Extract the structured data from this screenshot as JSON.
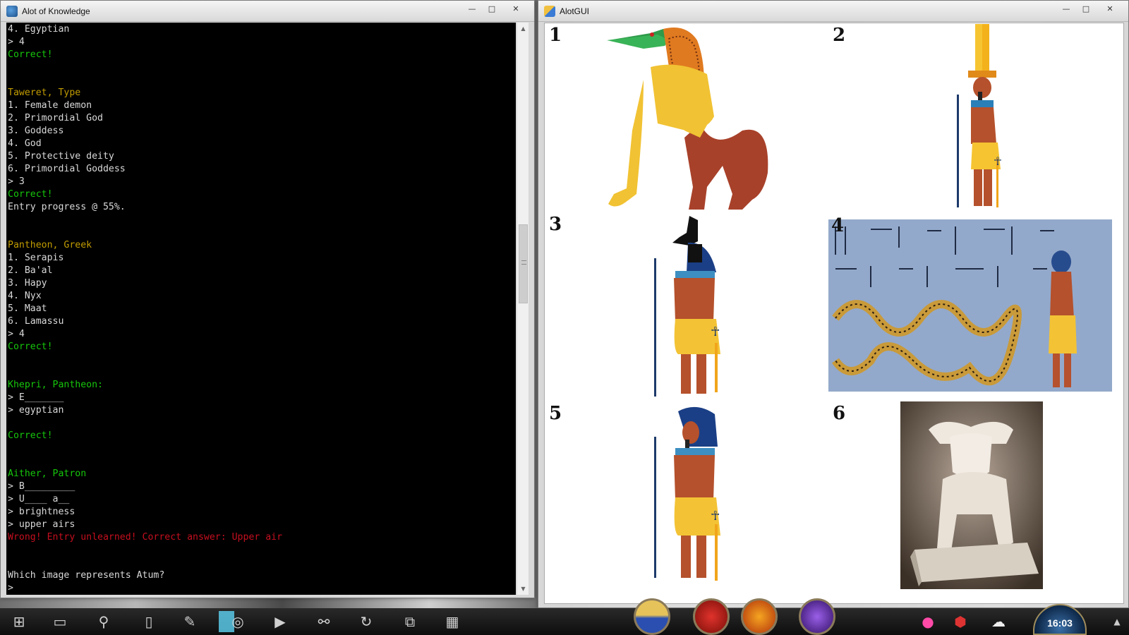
{
  "console_window": {
    "title": "Alot of Knowledge",
    "controls": {
      "minimize": "—",
      "maximize": "□",
      "close": "✕"
    },
    "lines": [
      {
        "text": "4. Egyptian",
        "style": "normal"
      },
      {
        "text": "> 4",
        "style": "normal"
      },
      {
        "text": "Correct!",
        "style": "green"
      },
      {
        "text": "",
        "style": "normal"
      },
      {
        "text": "",
        "style": "normal"
      },
      {
        "text": "Taweret, Type",
        "style": "olive"
      },
      {
        "text": "1. Female demon",
        "style": "normal"
      },
      {
        "text": "2. Primordial God",
        "style": "normal"
      },
      {
        "text": "3. Goddess",
        "style": "normal"
      },
      {
        "text": "4. God",
        "style": "normal"
      },
      {
        "text": "5. Protective deity",
        "style": "normal"
      },
      {
        "text": "6. Primordial Goddess",
        "style": "normal"
      },
      {
        "text": "> 3",
        "style": "normal"
      },
      {
        "text": "Correct!",
        "style": "green"
      },
      {
        "text": "Entry progress @ 55%.",
        "style": "normal"
      },
      {
        "text": "",
        "style": "normal"
      },
      {
        "text": "",
        "style": "normal"
      },
      {
        "text": "Pantheon, Greek",
        "style": "olive"
      },
      {
        "text": "1. Serapis",
        "style": "normal"
      },
      {
        "text": "2. Ba'al",
        "style": "normal"
      },
      {
        "text": "3. Hapy",
        "style": "normal"
      },
      {
        "text": "4. Nyx",
        "style": "normal"
      },
      {
        "text": "5. Maat",
        "style": "normal"
      },
      {
        "text": "6. Lamassu",
        "style": "normal"
      },
      {
        "text": "> 4",
        "style": "normal"
      },
      {
        "text": "Correct!",
        "style": "green"
      },
      {
        "text": "",
        "style": "normal"
      },
      {
        "text": "",
        "style": "normal"
      },
      {
        "text": "Khepri, Pantheon:",
        "style": "green"
      },
      {
        "text": "> E_______",
        "style": "normal"
      },
      {
        "text": "> egyptian",
        "style": "normal"
      },
      {
        "text": "",
        "style": "normal"
      },
      {
        "text": "Correct!",
        "style": "green"
      },
      {
        "text": "",
        "style": "normal"
      },
      {
        "text": "",
        "style": "normal"
      },
      {
        "text": "Aither, Patron",
        "style": "green"
      },
      {
        "text": "> B_________",
        "style": "normal"
      },
      {
        "text": "> U____ a__",
        "style": "normal"
      },
      {
        "text": "> brightness",
        "style": "normal"
      },
      {
        "text": "> upper airs",
        "style": "normal"
      },
      {
        "text": "Wrong! Entry unlearned! Correct answer: Upper air",
        "style": "red"
      },
      {
        "text": "",
        "style": "normal"
      },
      {
        "text": "",
        "style": "normal"
      },
      {
        "text": "Which image represents Atum?",
        "style": "normal"
      },
      {
        "text": ">",
        "style": "normal"
      }
    ]
  },
  "gui_window": {
    "title": "AlotGUI",
    "controls": {
      "minimize": "—",
      "maximize": "□",
      "close": "✕"
    },
    "images": [
      {
        "number": "1",
        "depicts": "crocodile-headed lion-hippo creature"
      },
      {
        "number": "2",
        "depicts": "god with tall plumed crown holding staff and ankh"
      },
      {
        "number": "3",
        "depicts": "jackal-headed god holding staff and ankh"
      },
      {
        "number": "4",
        "depicts": "wall relief of serpent with hieroglyphs and figure"
      },
      {
        "number": "5",
        "depicts": "pharaoh god with nemes headdress holding staff and ankh"
      },
      {
        "number": "6",
        "depicts": "stone statue of a bull"
      }
    ]
  },
  "taskbar": {
    "icons": [
      "start-icon",
      "desktop-icon",
      "search-icon",
      "document-icon",
      "pen-icon",
      "chrome-icon",
      "play-icon",
      "steam-icon",
      "circular-arrow-icon",
      "python-icon",
      "windows-flag-icon"
    ],
    "clock": "16:03"
  },
  "colors": {
    "console_bg": "#000000",
    "console_text": "#d9d9d9",
    "green": "#16c60c",
    "olive": "#c19c00",
    "red": "#c50f1f"
  }
}
